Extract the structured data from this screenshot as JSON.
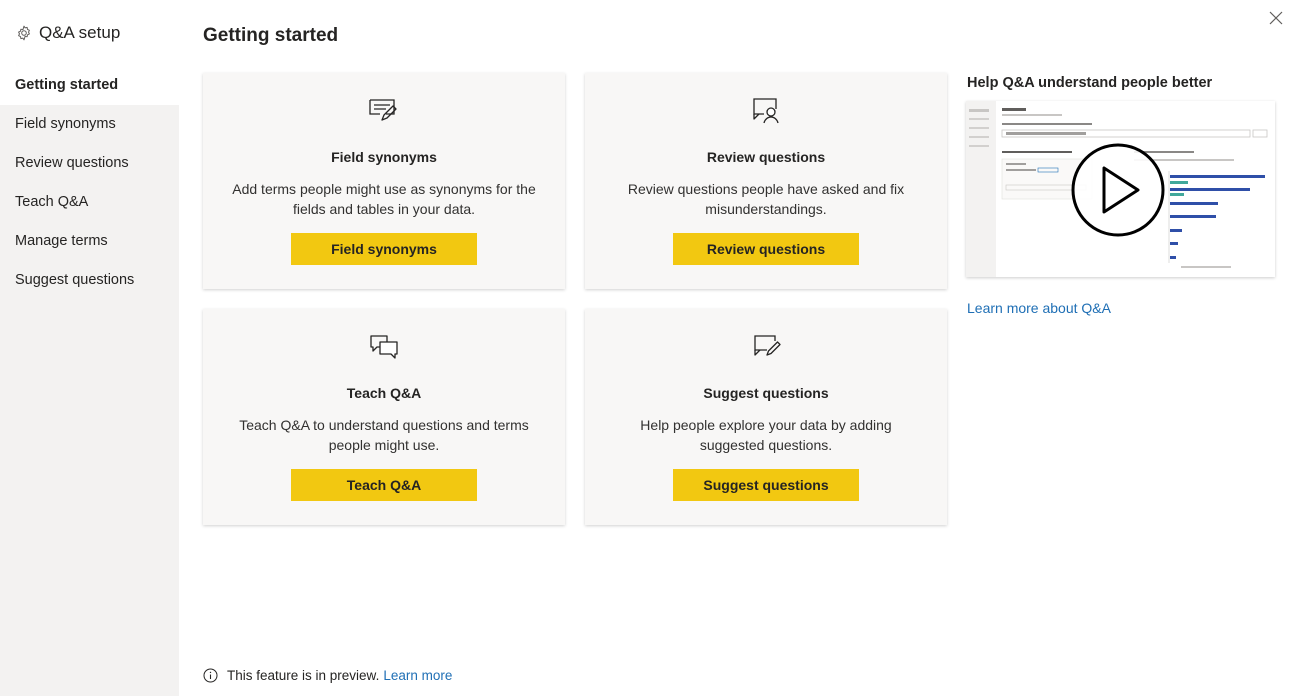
{
  "sidebar": {
    "header_title": "Q&A setup",
    "items": [
      {
        "label": "Getting started",
        "active": true
      },
      {
        "label": "Field synonyms"
      },
      {
        "label": "Review questions"
      },
      {
        "label": "Teach Q&A"
      },
      {
        "label": "Manage terms"
      },
      {
        "label": "Suggest questions"
      }
    ]
  },
  "page": {
    "title": "Getting started"
  },
  "cards": [
    {
      "icon": "synonyms-icon",
      "title": "Field synonyms",
      "description": "Add terms people might use as synonyms for the fields and tables in your data.",
      "button": "Field synonyms"
    },
    {
      "icon": "review-questions-icon",
      "title": "Review questions",
      "description": "Review questions people have asked and fix misunderstandings.",
      "button": "Review questions"
    },
    {
      "icon": "teach-qna-icon",
      "title": "Teach Q&A",
      "description": "Teach Q&A to understand questions and terms people might use.",
      "button": "Teach Q&A"
    },
    {
      "icon": "suggest-questions-icon",
      "title": "Suggest questions",
      "description": "Help people explore your data by adding suggested questions.",
      "button": "Suggest questions"
    }
  ],
  "help": {
    "title": "Help Q&A understand people better",
    "link": "Learn more about Q&A"
  },
  "footer": {
    "text": "This feature is in preview.",
    "link": "Learn more"
  },
  "colors": {
    "accent_button": "#f2c811",
    "link": "#1f6fb5",
    "sidebar_bg": "#f3f2f1",
    "card_bg": "#f8f7f6"
  }
}
